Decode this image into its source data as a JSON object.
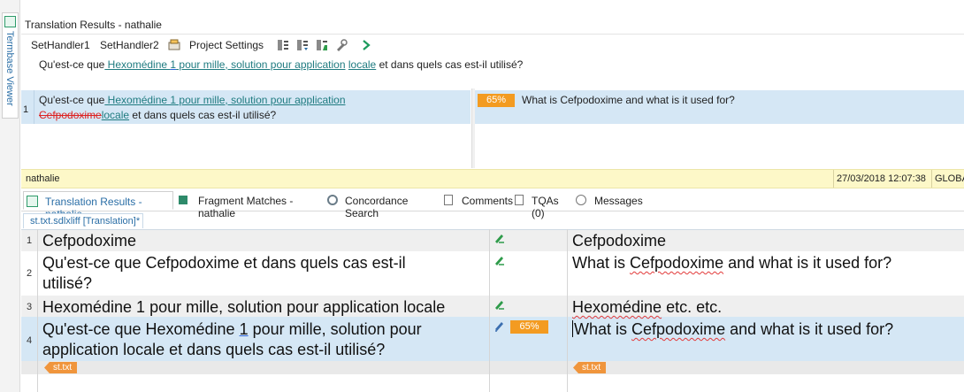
{
  "side_panel": {
    "label": "Termbase Viewer"
  },
  "results_panel": {
    "title": "Translation Results - nathalie",
    "toolbar": {
      "set_handler1": "SetHandler1",
      "set_handler2": "SetHandler2",
      "project_settings": "Project Settings"
    },
    "source_line": {
      "pre": "Qu'est-ce que",
      "tu1": " Hexomédine ",
      "tu2": "1",
      "tu3": " pour mille, solution pour application",
      "tu4": "locale",
      "post": " et dans quels cas est-il utilisé?"
    },
    "result": {
      "number": "1",
      "line1_pre": "Qu'est-ce que",
      "line1_tu": " Hexomédine 1 pour mille, solution pour application",
      "line2_deleted": "Cefpodoxime",
      "line2_inserted": "locale",
      "line2_post": " et dans quels cas est-il utilisé?",
      "match_percent": "65%",
      "target": "What is Cefpodoxime and what is it used for?"
    },
    "status": {
      "user": "nathalie",
      "timestamp": "27/03/2018 12:07:38",
      "scope": "GLOBA"
    }
  },
  "tabs": [
    {
      "label": "Translation Results - nathalie"
    },
    {
      "label": "Fragment Matches - nathalie"
    },
    {
      "label": "Concordance Search"
    },
    {
      "label": "Comments"
    },
    {
      "label": "TQAs (0)"
    },
    {
      "label": "Messages"
    }
  ],
  "document_tab": "st.txt.sdlxliff [Translation]*",
  "segments": [
    {
      "number": "1",
      "source": "Cefpodoxime",
      "target": "Cefpodoxime"
    },
    {
      "number": "2",
      "source_line1": "Qu'est-ce que Cefpodoxime et dans quels cas est-il",
      "source_line2": "utilisé?",
      "target_pre": "What is ",
      "target_term": "Cefpodoxime",
      "target_post": " and what is it used for?"
    },
    {
      "number": "3",
      "source": "Hexomédine 1 pour mille, solution pour application locale",
      "target_term": "Hexomédine",
      "target_post": " etc. etc."
    },
    {
      "number": "4",
      "source_line1_pre": "Qu'est-ce que Hexomédine ",
      "source_line1_num": "1",
      "source_line1_post": " pour mille, solution pour",
      "source_line2": "application locale et dans quels cas est-il utilisé?",
      "match_percent": "65%",
      "target_pre": "What is ",
      "target_term": "Cefpodoxime",
      "target_post": " and what is it used for?"
    }
  ],
  "file_tag": "st.txt",
  "colors": {
    "active_row": "#d5e7f5",
    "match_badge": "#f39b21",
    "status_bar": "#fdf8c8",
    "file_tag": "#f0953c"
  }
}
